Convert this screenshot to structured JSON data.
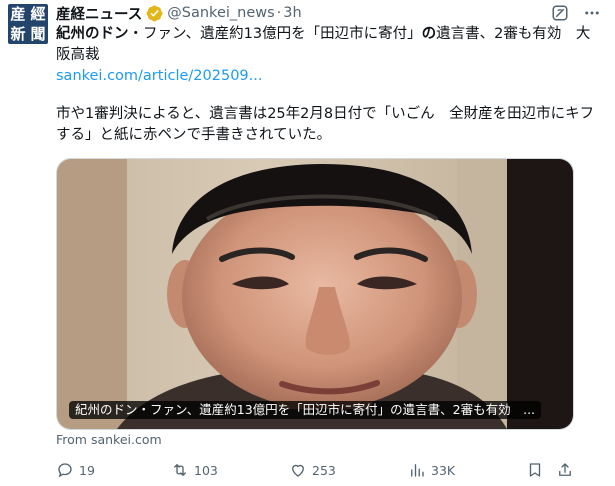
{
  "author": {
    "avatar_chars": [
      "産",
      "經",
      "新",
      "聞"
    ],
    "name": "産経ニュース",
    "handle": "@Sankei_news",
    "separator": "·",
    "time": "3h"
  },
  "post": {
    "headline_bold_1": "紀州のドン",
    "headline_mid": "・ファン、遺産約13億円を「田辺市に寄付」",
    "headline_bold_2": "の",
    "headline_end": "遺言書、2審も有効　大阪高裁",
    "link": "sankei.com/article/202509...",
    "paragraph": "市や1審判決によると、遺言書は25年2月8日付で「いごん　全財産を田辺市にキフする」と紙に赤ペンで手書きされていた。"
  },
  "media": {
    "caption": "紀州のドン・ファン、遺産約13億円を「田辺市に寄付」の遺言書、2審も有効　..."
  },
  "source": "From sankei.com",
  "actions": {
    "replies": "19",
    "reposts": "103",
    "likes": "253",
    "views": "33K"
  },
  "colors": {
    "link": "#1d9bf0",
    "secondary_text": "#536471",
    "verified": "#e2b719",
    "avatar_bg": "#23456b"
  },
  "icons": [
    "verified-badge-icon",
    "grok-icon",
    "more-icon",
    "reply-icon",
    "retweet-icon",
    "like-icon",
    "views-icon",
    "bookmark-icon",
    "share-icon"
  ]
}
